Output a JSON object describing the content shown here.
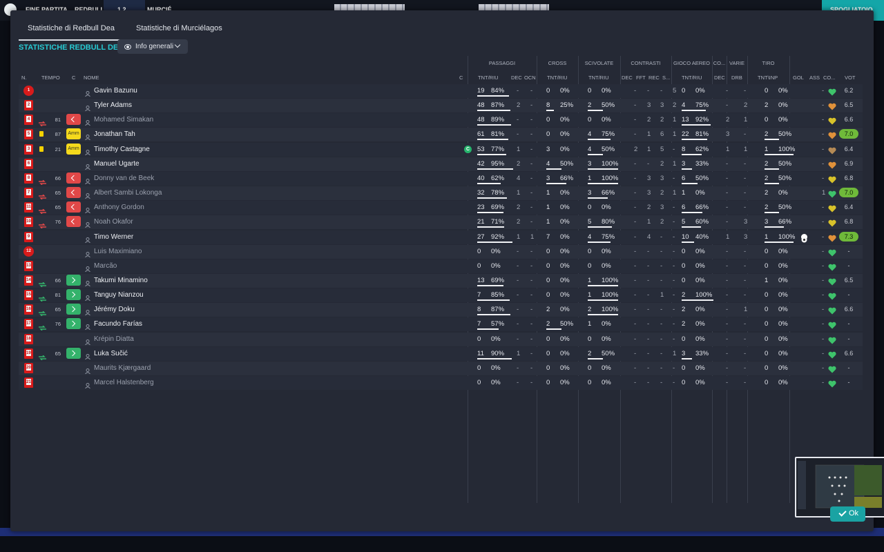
{
  "topbar": {
    "left_label": "FINE PARTITA",
    "home_short": "REDBULL",
    "score": "1  2",
    "away_short": "MURCIÉ",
    "right_button": "SPOGLIATOIO"
  },
  "tabs": [
    "Statistiche di Redbull Dea",
    "Statistiche di Murciélagos"
  ],
  "section_title": "STATISTICHE REDBULL DEA",
  "dropdown_label": "Info generali",
  "groups": [
    "PASSAGGI",
    "CROSS",
    "SCIVOLATE",
    "CONTRASTI",
    "GIOCO AEREO",
    "CO...",
    "VARIE",
    "TIRO"
  ],
  "columns": {
    "n": "N.",
    "tempo": "TEMPO",
    "c": "C",
    "nome": "NOME",
    "c2": "C",
    "pass_tnt": "TNT/RIU",
    "pass_dec": "DEC",
    "pass_ocn": "OCN",
    "cross_tnt": "TNT/RIU",
    "scivo_tnt": "TNT/RIU",
    "con_dec": "DEC",
    "con_fft": "FFT",
    "con_rec": "REC",
    "con_s": "S...",
    "aereo_tnt": "TNT/RIU",
    "co_dec": "DEC",
    "varie_drb": "DRB",
    "tiro": "TNT\\INP",
    "gol": "GOL",
    "ass": "ASS",
    "co": "CO...",
    "vot": "VOT"
  },
  "ok_label": "Ok",
  "icons": {
    "substitution": "swap-arrows-icon",
    "person": "person-icon",
    "heart": "condition-heart-icon",
    "ball": "goal-ball-icon"
  },
  "colors": {
    "accent": "#27c9d2",
    "out": "#e14848",
    "in": "#34b26b",
    "yellow": "#f5d91c",
    "good_vote": "#6fba3a"
  },
  "players": [
    {
      "num": "1",
      "gk": true,
      "sub": "",
      "minute": "",
      "badge": "",
      "name": "Gavin Bazunu",
      "dim": false,
      "cap": false,
      "pass": [
        "19",
        "84%"
      ],
      "pbar": 0.84,
      "pdec": "-",
      "pocn": "-",
      "cross": [
        "0",
        "0%"
      ],
      "cbar": 0,
      "scivo": [
        "0",
        "0%"
      ],
      "sbar": 0,
      "con": [
        "-",
        "-",
        "-",
        "5"
      ],
      "aereo": [
        "0",
        "0%"
      ],
      "abar": 0,
      "codec": "-",
      "drb": "-",
      "tiro": [
        "0",
        "0%"
      ],
      "tbar": 0,
      "gol": "",
      "ass": "-",
      "heart": "g",
      "vot": "6.2",
      "good": false
    },
    {
      "num": "2",
      "gk": false,
      "sub": "",
      "minute": "",
      "badge": "",
      "name": "Tyler Adams",
      "dim": false,
      "cap": false,
      "pass": [
        "48",
        "87%"
      ],
      "pbar": 0.87,
      "pdec": "2",
      "pocn": "-",
      "cross": [
        "8",
        "25%"
      ],
      "cbar": 0.25,
      "scivo": [
        "2",
        "50%"
      ],
      "sbar": 0.5,
      "con": [
        "-",
        "3",
        "3",
        "2"
      ],
      "aereo": [
        "4",
        "75%"
      ],
      "abar": 0.75,
      "codec": "-",
      "drb": "2",
      "tiro": [
        "2",
        "0%"
      ],
      "tbar": 0,
      "gol": "",
      "ass": "-",
      "heart": "o",
      "vot": "6.5",
      "good": false
    },
    {
      "num": "4",
      "gk": false,
      "sub": "out",
      "minute": "81",
      "badge": "out",
      "name": "Mohamed Simakan",
      "dim": true,
      "cap": false,
      "pass": [
        "48",
        "89%"
      ],
      "pbar": 0.89,
      "pdec": "-",
      "pocn": "-",
      "cross": [
        "0",
        "0%"
      ],
      "cbar": 0,
      "scivo": [
        "0",
        "0%"
      ],
      "sbar": 0,
      "con": [
        "-",
        "2",
        "2",
        "1"
      ],
      "aereo": [
        "13",
        "92%"
      ],
      "abar": 0.92,
      "codec": "2",
      "drb": "1",
      "tiro": [
        "0",
        "0%"
      ],
      "tbar": 0,
      "gol": "",
      "ass": "-",
      "heart": "y",
      "vot": "6.6",
      "good": false
    },
    {
      "num": "5",
      "gk": false,
      "sub": "card",
      "minute": "87",
      "badge": "amm",
      "name": "Jonathan Tah",
      "dim": false,
      "cap": false,
      "pass": [
        "61",
        "81%"
      ],
      "pbar": 0.81,
      "pdec": "-",
      "pocn": "-",
      "cross": [
        "0",
        "0%"
      ],
      "cbar": 0,
      "scivo": [
        "4",
        "75%"
      ],
      "sbar": 0.75,
      "con": [
        "-",
        "1",
        "6",
        "1"
      ],
      "aereo": [
        "22",
        "81%"
      ],
      "abar": 0.81,
      "codec": "3",
      "drb": "-",
      "tiro": [
        "2",
        "50%"
      ],
      "tbar": 0.5,
      "gol": "",
      "ass": "-",
      "heart": "o",
      "vot": "7.0",
      "good": true
    },
    {
      "num": "3",
      "gk": false,
      "sub": "card",
      "minute": "21",
      "badge": "amm",
      "name": "Timothy Castagne",
      "dim": false,
      "cap": true,
      "pass": [
        "53",
        "77%"
      ],
      "pbar": 0.77,
      "pdec": "1",
      "pocn": "-",
      "cross": [
        "3",
        "0%"
      ],
      "cbar": 0,
      "scivo": [
        "4",
        "50%"
      ],
      "sbar": 0.5,
      "con": [
        "2",
        "1",
        "5",
        "-"
      ],
      "aereo": [
        "8",
        "62%"
      ],
      "abar": 0.62,
      "codec": "1",
      "drb": "1",
      "tiro": [
        "1",
        "100%"
      ],
      "tbar": 1,
      "gol": "",
      "ass": "-",
      "heart": "b",
      "vot": "6.4",
      "good": false
    },
    {
      "num": "6",
      "gk": false,
      "sub": "",
      "minute": "",
      "badge": "",
      "name": "Manuel Ugarte",
      "dim": false,
      "cap": false,
      "pass": [
        "42",
        "95%"
      ],
      "pbar": 0.95,
      "pdec": "2",
      "pocn": "-",
      "cross": [
        "4",
        "50%"
      ],
      "cbar": 0.5,
      "scivo": [
        "3",
        "100%"
      ],
      "sbar": 1,
      "con": [
        "-",
        "-",
        "2",
        "1"
      ],
      "aereo": [
        "3",
        "33%"
      ],
      "abar": 0.33,
      "codec": "-",
      "drb": "-",
      "tiro": [
        "2",
        "50%"
      ],
      "tbar": 0.5,
      "gol": "",
      "ass": "-",
      "heart": "o",
      "vot": "6.9",
      "good": false
    },
    {
      "num": "8",
      "gk": false,
      "sub": "out",
      "minute": "66",
      "badge": "out",
      "name": "Donny van de Beek",
      "dim": true,
      "cap": false,
      "pass": [
        "40",
        "62%"
      ],
      "pbar": 0.62,
      "pdec": "4",
      "pocn": "-",
      "cross": [
        "3",
        "66%"
      ],
      "cbar": 0.66,
      "scivo": [
        "1",
        "100%"
      ],
      "sbar": 1,
      "con": [
        "-",
        "3",
        "3",
        "-"
      ],
      "aereo": [
        "6",
        "50%"
      ],
      "abar": 0.5,
      "codec": "-",
      "drb": "-",
      "tiro": [
        "2",
        "50%"
      ],
      "tbar": 0.5,
      "gol": "",
      "ass": "-",
      "heart": "y",
      "vot": "6.8",
      "good": false
    },
    {
      "num": "7",
      "gk": false,
      "sub": "out",
      "minute": "65",
      "badge": "out",
      "name": "Albert Sambi Lokonga",
      "dim": true,
      "cap": false,
      "pass": [
        "32",
        "78%"
      ],
      "pbar": 0.78,
      "pdec": "1",
      "pocn": "-",
      "cross": [
        "1",
        "0%"
      ],
      "cbar": 0,
      "scivo": [
        "3",
        "66%"
      ],
      "sbar": 0.66,
      "con": [
        "-",
        "3",
        "2",
        "1"
      ],
      "aereo": [
        "1",
        "0%"
      ],
      "abar": 0,
      "codec": "-",
      "drb": "-",
      "tiro": [
        "2",
        "0%"
      ],
      "tbar": 0,
      "gol": "",
      "ass": "1",
      "heart": "g",
      "vot": "7.0",
      "good": true
    },
    {
      "num": "11",
      "gk": false,
      "sub": "out",
      "minute": "65",
      "badge": "out",
      "name": "Anthony Gordon",
      "dim": true,
      "cap": false,
      "pass": [
        "23",
        "69%"
      ],
      "pbar": 0.69,
      "pdec": "2",
      "pocn": "-",
      "cross": [
        "1",
        "0%"
      ],
      "cbar": 0,
      "scivo": [
        "0",
        "0%"
      ],
      "sbar": 0,
      "con": [
        "-",
        "2",
        "3",
        "-"
      ],
      "aereo": [
        "6",
        "66%"
      ],
      "abar": 0.66,
      "codec": "-",
      "drb": "-",
      "tiro": [
        "2",
        "50%"
      ],
      "tbar": 0.5,
      "gol": "",
      "ass": "-",
      "heart": "y",
      "vot": "6.4",
      "good": false
    },
    {
      "num": "10",
      "gk": false,
      "sub": "out",
      "minute": "76",
      "badge": "out",
      "name": "Noah Okafor",
      "dim": true,
      "cap": false,
      "pass": [
        "21",
        "71%"
      ],
      "pbar": 0.71,
      "pdec": "2",
      "pocn": "-",
      "cross": [
        "1",
        "0%"
      ],
      "cbar": 0,
      "scivo": [
        "5",
        "80%"
      ],
      "sbar": 0.8,
      "con": [
        "-",
        "1",
        "2",
        "-"
      ],
      "aereo": [
        "5",
        "60%"
      ],
      "abar": 0.6,
      "codec": "-",
      "drb": "3",
      "tiro": [
        "3",
        "66%"
      ],
      "tbar": 0.66,
      "gol": "",
      "ass": "-",
      "heart": "y",
      "vot": "6.8",
      "good": false
    },
    {
      "num": "9",
      "gk": false,
      "sub": "",
      "minute": "",
      "badge": "",
      "name": "Timo Werner",
      "dim": false,
      "cap": false,
      "pass": [
        "27",
        "92%"
      ],
      "pbar": 0.92,
      "pdec": "1",
      "pocn": "1",
      "cross": [
        "7",
        "0%"
      ],
      "cbar": 0,
      "scivo": [
        "4",
        "75%"
      ],
      "sbar": 0.75,
      "con": [
        "-",
        "4",
        "-",
        "-"
      ],
      "aereo": [
        "10",
        "40%"
      ],
      "abar": 0.4,
      "codec": "1",
      "drb": "3",
      "tiro": [
        "1",
        "100%"
      ],
      "tbar": 1,
      "gol": "ball",
      "ass": "-",
      "heart": "o",
      "vot": "7.3",
      "good": true
    },
    {
      "num": "12",
      "gk": true,
      "sub": "",
      "minute": "",
      "badge": "",
      "name": "Luis Maximiano",
      "dim": true,
      "cap": false,
      "pass": [
        "0",
        "0%"
      ],
      "pbar": 0,
      "pdec": "-",
      "pocn": "-",
      "cross": [
        "0",
        "0%"
      ],
      "cbar": 0,
      "scivo": [
        "0",
        "0%"
      ],
      "sbar": 0,
      "con": [
        "-",
        "-",
        "-",
        "-"
      ],
      "aereo": [
        "0",
        "0%"
      ],
      "abar": 0,
      "codec": "-",
      "drb": "-",
      "tiro": [
        "0",
        "0%"
      ],
      "tbar": 0,
      "gol": "",
      "ass": "-",
      "heart": "g",
      "vot": "-",
      "good": false
    },
    {
      "num": "13",
      "gk": false,
      "sub": "",
      "minute": "",
      "badge": "",
      "name": "Marcão",
      "dim": true,
      "cap": false,
      "pass": [
        "0",
        "0%"
      ],
      "pbar": 0,
      "pdec": "-",
      "pocn": "-",
      "cross": [
        "0",
        "0%"
      ],
      "cbar": 0,
      "scivo": [
        "0",
        "0%"
      ],
      "sbar": 0,
      "con": [
        "-",
        "-",
        "-",
        "-"
      ],
      "aereo": [
        "0",
        "0%"
      ],
      "abar": 0,
      "codec": "-",
      "drb": "-",
      "tiro": [
        "0",
        "0%"
      ],
      "tbar": 0,
      "gol": "",
      "ass": "-",
      "heart": "g",
      "vot": "-",
      "good": false
    },
    {
      "num": "14",
      "gk": false,
      "sub": "in",
      "minute": "66",
      "badge": "in",
      "name": "Takumi Minamino",
      "dim": false,
      "cap": false,
      "pass": [
        "13",
        "69%"
      ],
      "pbar": 0.69,
      "pdec": "-",
      "pocn": "-",
      "cross": [
        "0",
        "0%"
      ],
      "cbar": 0,
      "scivo": [
        "1",
        "100%"
      ],
      "sbar": 1,
      "con": [
        "-",
        "-",
        "-",
        "-"
      ],
      "aereo": [
        "0",
        "0%"
      ],
      "abar": 0,
      "codec": "-",
      "drb": "-",
      "tiro": [
        "1",
        "0%"
      ],
      "tbar": 0,
      "gol": "",
      "ass": "-",
      "heart": "g",
      "vot": "6.5",
      "good": false
    },
    {
      "num": "15",
      "gk": false,
      "sub": "in",
      "minute": "81",
      "badge": "in",
      "name": "Tanguy Nianzou",
      "dim": false,
      "cap": false,
      "pass": [
        "7",
        "85%"
      ],
      "pbar": 0.85,
      "pdec": "-",
      "pocn": "-",
      "cross": [
        "0",
        "0%"
      ],
      "cbar": 0,
      "scivo": [
        "1",
        "100%"
      ],
      "sbar": 1,
      "con": [
        "-",
        "-",
        "1",
        "-"
      ],
      "aereo": [
        "2",
        "100%"
      ],
      "abar": 1,
      "codec": "-",
      "drb": "-",
      "tiro": [
        "0",
        "0%"
      ],
      "tbar": 0,
      "gol": "",
      "ass": "-",
      "heart": "g",
      "vot": "-",
      "good": false
    },
    {
      "num": "16",
      "gk": false,
      "sub": "in",
      "minute": "65",
      "badge": "in",
      "name": "Jérémy Doku",
      "dim": false,
      "cap": false,
      "pass": [
        "8",
        "87%"
      ],
      "pbar": 0.87,
      "pdec": "-",
      "pocn": "-",
      "cross": [
        "2",
        "0%"
      ],
      "cbar": 0,
      "scivo": [
        "2",
        "100%"
      ],
      "sbar": 1,
      "con": [
        "-",
        "-",
        "-",
        "-"
      ],
      "aereo": [
        "2",
        "0%"
      ],
      "abar": 0,
      "codec": "-",
      "drb": "1",
      "tiro": [
        "0",
        "0%"
      ],
      "tbar": 0,
      "gol": "",
      "ass": "-",
      "heart": "g",
      "vot": "6.6",
      "good": false
    },
    {
      "num": "17",
      "gk": false,
      "sub": "in",
      "minute": "76",
      "badge": "in",
      "name": "Facundo Farías",
      "dim": false,
      "cap": false,
      "pass": [
        "7",
        "57%"
      ],
      "pbar": 0.57,
      "pdec": "-",
      "pocn": "-",
      "cross": [
        "2",
        "50%"
      ],
      "cbar": 0.5,
      "scivo": [
        "1",
        "0%"
      ],
      "sbar": 0,
      "con": [
        "-",
        "-",
        "-",
        "-"
      ],
      "aereo": [
        "2",
        "0%"
      ],
      "abar": 0,
      "codec": "-",
      "drb": "-",
      "tiro": [
        "0",
        "0%"
      ],
      "tbar": 0,
      "gol": "",
      "ass": "-",
      "heart": "g",
      "vot": "-",
      "good": false
    },
    {
      "num": "18",
      "gk": false,
      "sub": "",
      "minute": "",
      "badge": "",
      "name": "Krépin Diatta",
      "dim": true,
      "cap": false,
      "pass": [
        "0",
        "0%"
      ],
      "pbar": 0,
      "pdec": "-",
      "pocn": "-",
      "cross": [
        "0",
        "0%"
      ],
      "cbar": 0,
      "scivo": [
        "0",
        "0%"
      ],
      "sbar": 0,
      "con": [
        "-",
        "-",
        "-",
        "-"
      ],
      "aereo": [
        "0",
        "0%"
      ],
      "abar": 0,
      "codec": "-",
      "drb": "-",
      "tiro": [
        "0",
        "0%"
      ],
      "tbar": 0,
      "gol": "",
      "ass": "-",
      "heart": "g",
      "vot": "-",
      "good": false
    },
    {
      "num": "19",
      "gk": false,
      "sub": "in",
      "minute": "65",
      "badge": "in",
      "name": "Luka Sučić",
      "dim": false,
      "cap": false,
      "pass": [
        "11",
        "90%"
      ],
      "pbar": 0.9,
      "pdec": "1",
      "pocn": "-",
      "cross": [
        "0",
        "0%"
      ],
      "cbar": 0,
      "scivo": [
        "2",
        "50%"
      ],
      "sbar": 0.5,
      "con": [
        "-",
        "-",
        "-",
        "1"
      ],
      "aereo": [
        "3",
        "33%"
      ],
      "abar": 0.33,
      "codec": "-",
      "drb": "-",
      "tiro": [
        "0",
        "0%"
      ],
      "tbar": 0,
      "gol": "",
      "ass": "-",
      "heart": "g",
      "vot": "6.6",
      "good": false
    },
    {
      "num": "20",
      "gk": false,
      "sub": "",
      "minute": "",
      "badge": "",
      "name": "Maurits Kjærgaard",
      "dim": true,
      "cap": false,
      "pass": [
        "0",
        "0%"
      ],
      "pbar": 0,
      "pdec": "-",
      "pocn": "-",
      "cross": [
        "0",
        "0%"
      ],
      "cbar": 0,
      "scivo": [
        "0",
        "0%"
      ],
      "sbar": 0,
      "con": [
        "-",
        "-",
        "-",
        "-"
      ],
      "aereo": [
        "0",
        "0%"
      ],
      "abar": 0,
      "codec": "-",
      "drb": "-",
      "tiro": [
        "0",
        "0%"
      ],
      "tbar": 0,
      "gol": "",
      "ass": "-",
      "heart": "g",
      "vot": "-",
      "good": false
    },
    {
      "num": "21",
      "gk": false,
      "sub": "",
      "minute": "",
      "badge": "",
      "name": "Marcel Halstenberg",
      "dim": true,
      "cap": false,
      "pass": [
        "0",
        "0%"
      ],
      "pbar": 0,
      "pdec": "-",
      "pocn": "-",
      "cross": [
        "0",
        "0%"
      ],
      "cbar": 0,
      "scivo": [
        "0",
        "0%"
      ],
      "sbar": 0,
      "con": [
        "-",
        "-",
        "-",
        "-"
      ],
      "aereo": [
        "0",
        "0%"
      ],
      "abar": 0,
      "codec": "-",
      "drb": "-",
      "tiro": [
        "0",
        "0%"
      ],
      "tbar": 0,
      "gol": "",
      "ass": "-",
      "heart": "g",
      "vot": "-",
      "good": false
    }
  ]
}
